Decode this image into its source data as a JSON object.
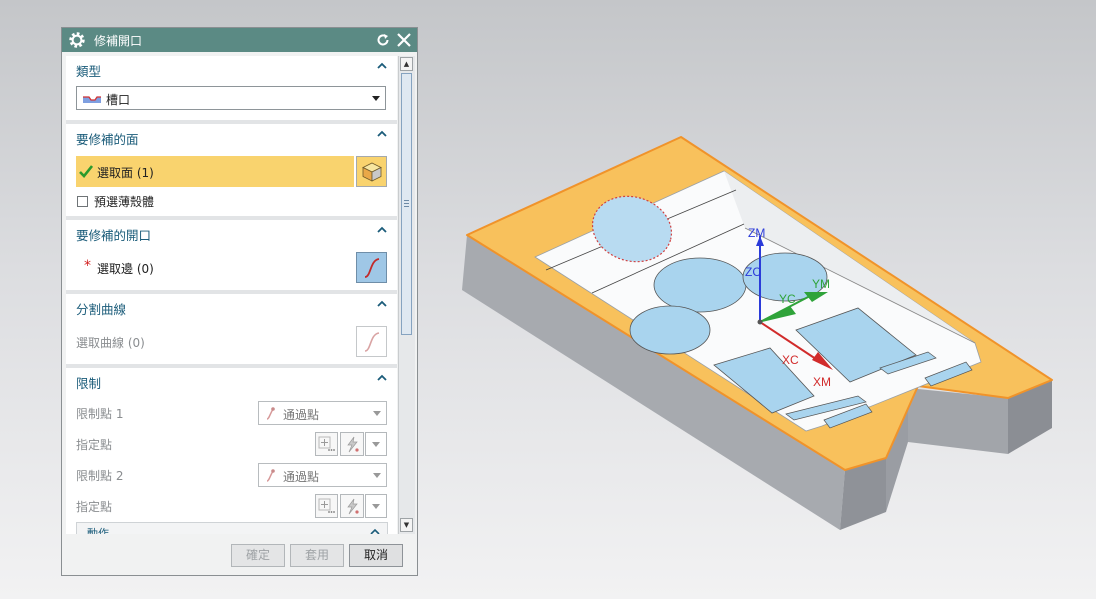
{
  "dialog": {
    "title": "修補開口",
    "icons": {
      "title": "gear-icon",
      "reset": "reset-icon",
      "close": "close-icon"
    }
  },
  "sections": {
    "type": {
      "header": "類型",
      "selected_value": "槽口",
      "icon": "slot-type-icon"
    },
    "faces": {
      "header": "要修補的面",
      "select_label": "選取面 (1)",
      "checkbox_label": "預選薄殼體",
      "checkbox_checked": false,
      "icon": "solid-cube-icon"
    },
    "opening": {
      "header": "要修補的開口",
      "select_label": "選取邊 (0)",
      "required_mark": "*",
      "icon": "curve-icon"
    },
    "split_curve": {
      "header": "分割曲線",
      "select_label": "選取曲線 (0)",
      "icon": "curve-icon"
    },
    "limits": {
      "header": "限制",
      "limit_point_1_label": "限制點 1",
      "limit_point_1_value": "通過點",
      "specify_point_1_label": "指定點",
      "limit_point_2_label": "限制點 2",
      "limit_point_2_value": "通過點",
      "specify_point_2_label": "指定點",
      "subpanel_label": "動作"
    }
  },
  "footer": {
    "ok": "確定",
    "apply": "套用",
    "cancel": "取消"
  },
  "viewport": {
    "axis_labels": {
      "zm": "ZM",
      "zc": "ZC",
      "yc": "YC",
      "ym": "YM",
      "xc": "XC",
      "xm": "XM"
    },
    "colors": {
      "top_face": "#f8c15c",
      "edge": "#f0932a",
      "side_light": "#a8abb0",
      "side_dark": "#8b8e94",
      "hole": "#a9d4ee",
      "z": "#2b3bd9",
      "y": "#2fa33a",
      "x": "#d12b2b"
    }
  }
}
